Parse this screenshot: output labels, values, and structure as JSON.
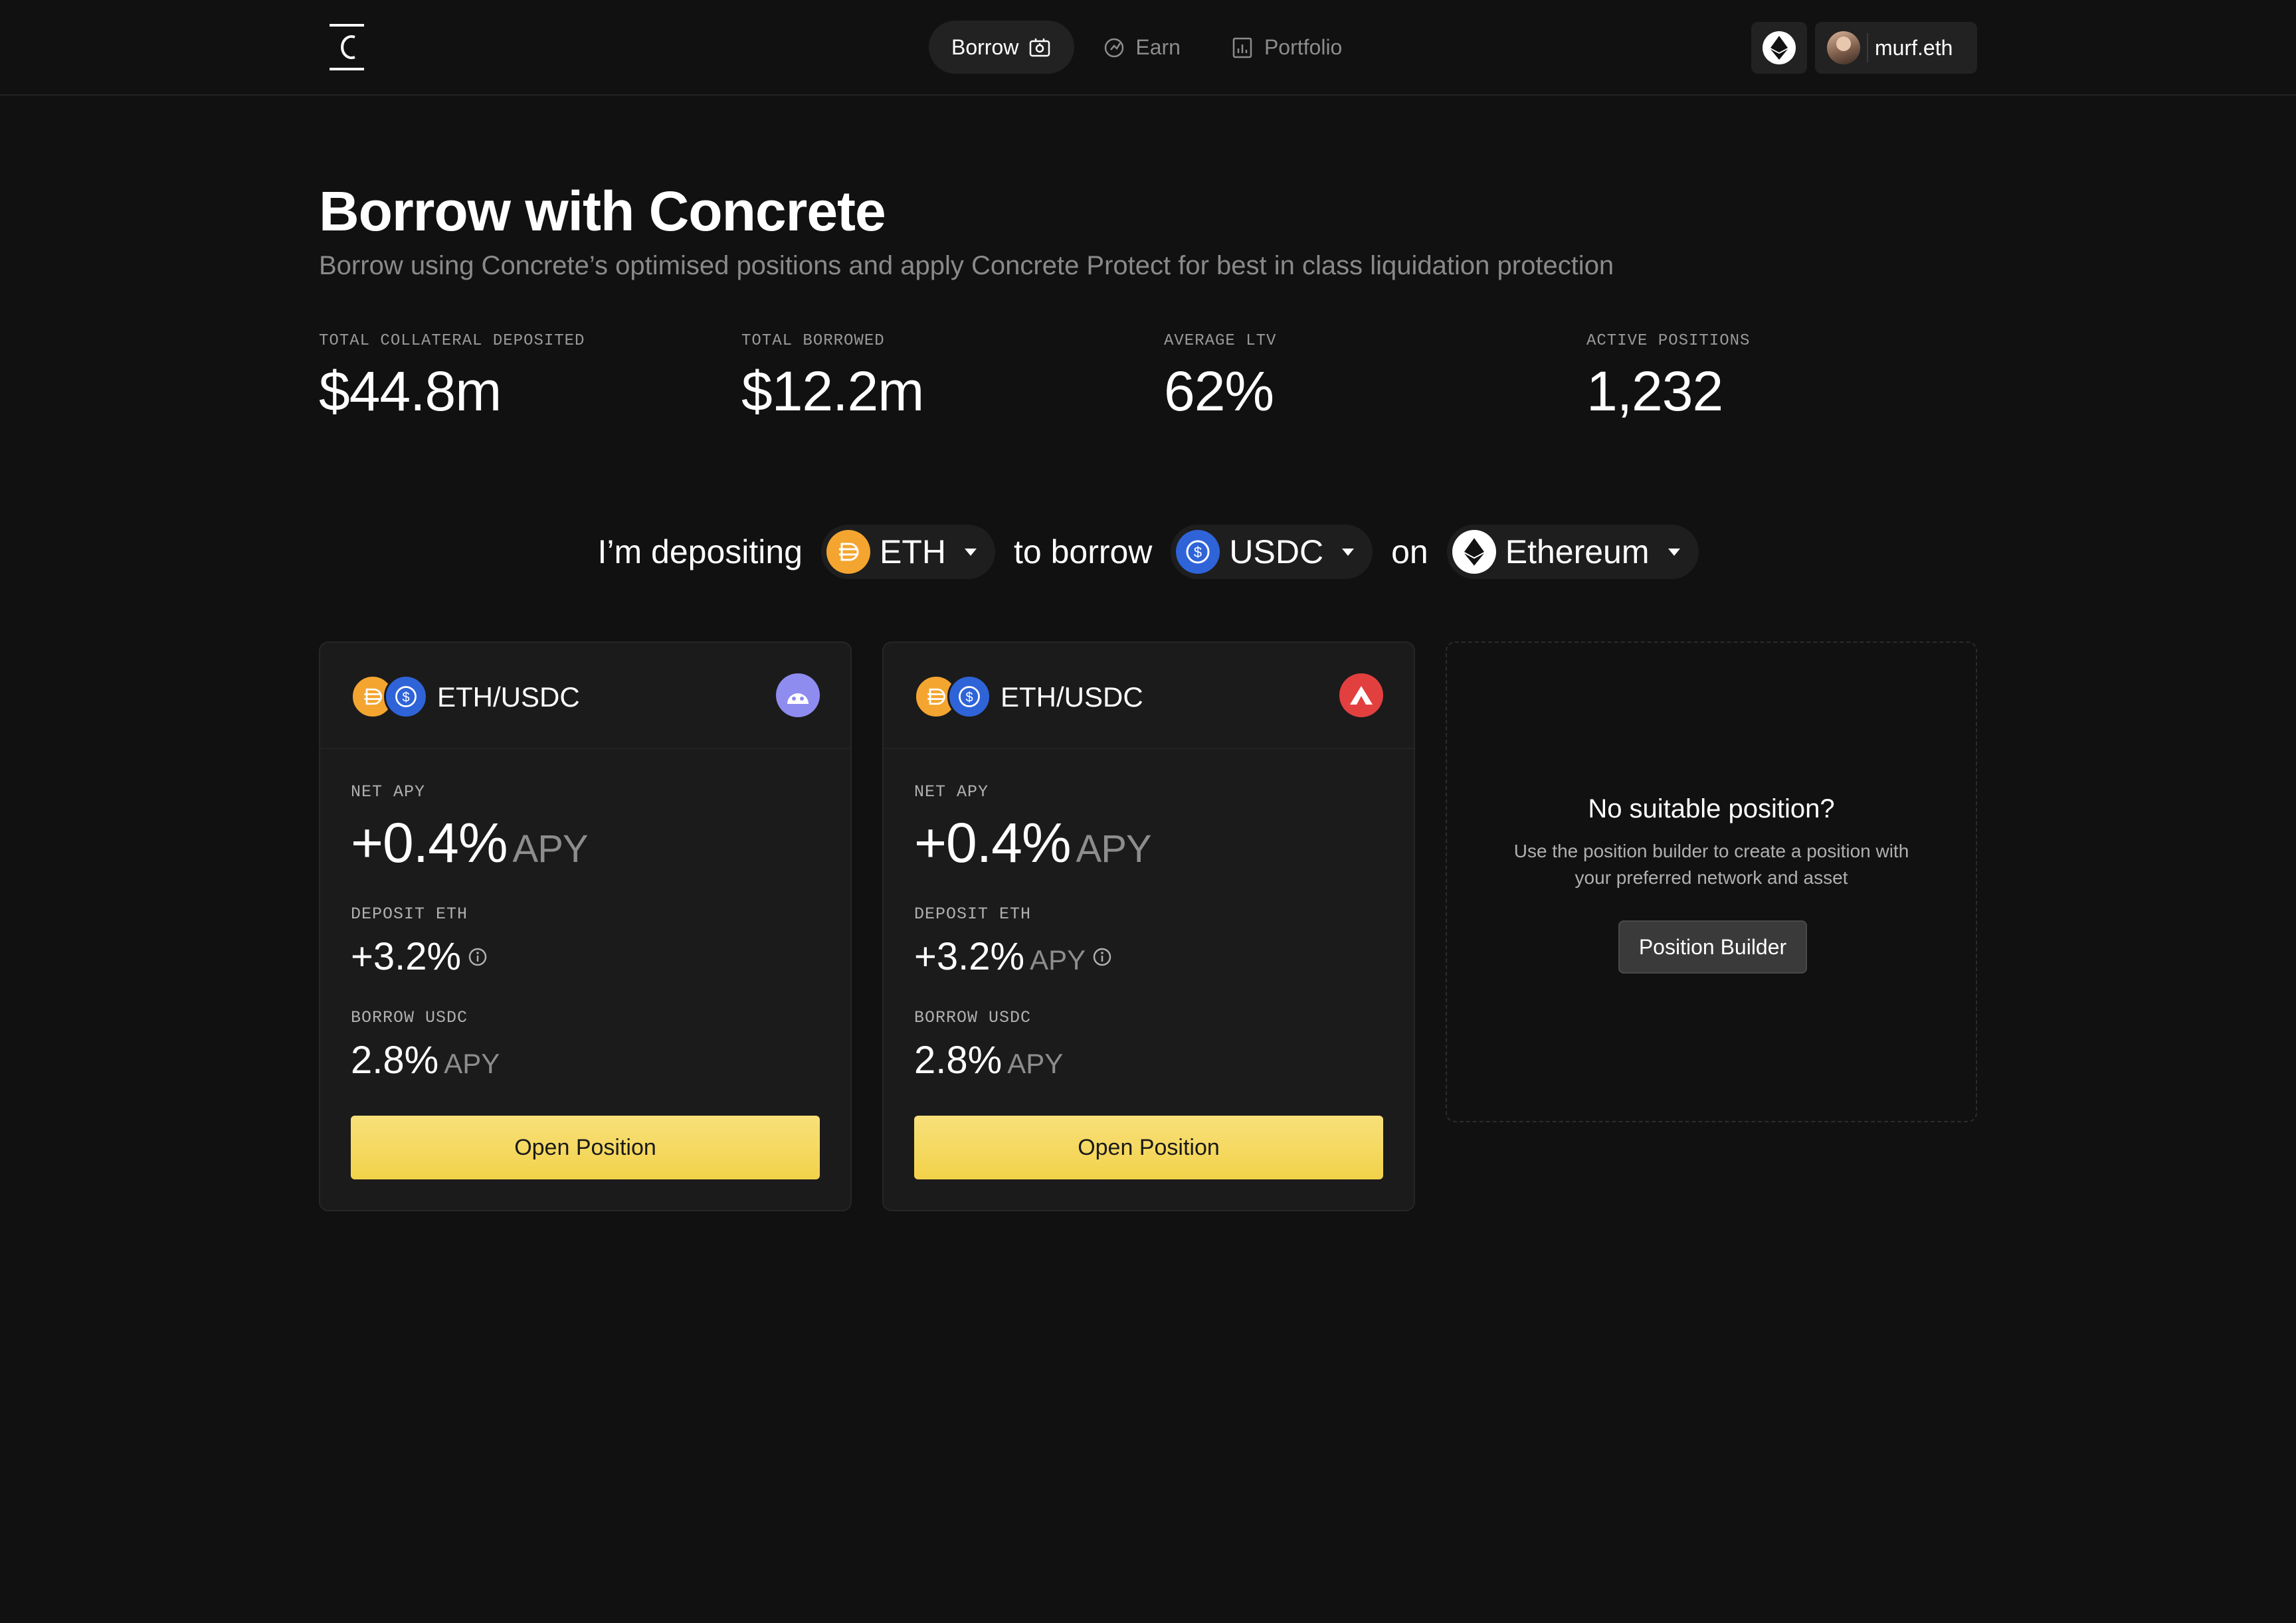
{
  "header": {
    "nav": [
      {
        "label": "Borrow",
        "icon": "borrow-icon",
        "active": true
      },
      {
        "label": "Earn",
        "icon": "earn-icon",
        "active": false
      },
      {
        "label": "Portfolio",
        "icon": "portfolio-icon",
        "active": false
      }
    ],
    "network_icon": "ethereum-icon",
    "user": {
      "name": "murf.eth"
    }
  },
  "hero": {
    "title": "Borrow with Concrete",
    "subtitle": "Borrow using Concrete’s optimised positions and apply Concrete Protect for best in class liquidation protection"
  },
  "stats": [
    {
      "label": "TOTAL COLLATERAL DEPOSITED",
      "value": "$44.8m"
    },
    {
      "label": "TOTAL BORROWED",
      "value": "$12.2m"
    },
    {
      "label": "AVERAGE LTV",
      "value": "62%"
    },
    {
      "label": "ACTIVE POSITIONS",
      "value": "1,232"
    }
  ],
  "selector": {
    "depositing_text": "I’m depositing",
    "deposit_asset": "ETH",
    "borrow_text": "to borrow",
    "borrow_asset": "USDC",
    "on_text": "on",
    "network": "Ethereum"
  },
  "cards": [
    {
      "pair": "ETH/USDC",
      "protocol_icon": "morpho-icon",
      "net_apy_label": "NET APY",
      "net_apy": "+0.4%",
      "net_apy_unit": "APY",
      "deposit_label": "DEPOSIT ETH",
      "deposit_apy": "+3.2%",
      "deposit_unit": "",
      "borrow_label": "BORROW USDC",
      "borrow_apy": "2.8%",
      "borrow_unit": "APY",
      "button": "Open Position"
    },
    {
      "pair": "ETH/USDC",
      "protocol_icon": "aave-icon",
      "net_apy_label": "NET APY",
      "net_apy": "+0.4%",
      "net_apy_unit": "APY",
      "deposit_label": "DEPOSIT ETH",
      "deposit_apy": "+3.2%",
      "deposit_unit": "APY",
      "borrow_label": "BORROW USDC",
      "borrow_apy": "2.8%",
      "borrow_unit": "APY",
      "button": "Open Position"
    }
  ],
  "builder": {
    "title": "No suitable position?",
    "text": "Use the position builder to create a position with your preferred network and asset",
    "button": "Position Builder"
  },
  "colors": {
    "background": "#111111",
    "card": "#1b1b1b",
    "accent_yellow": "#f5d65a",
    "eth_orange": "#f4a530",
    "usdc_blue": "#2f64d8",
    "morpho_purple": "#8f8cf0",
    "aave_red": "#e2403f"
  }
}
